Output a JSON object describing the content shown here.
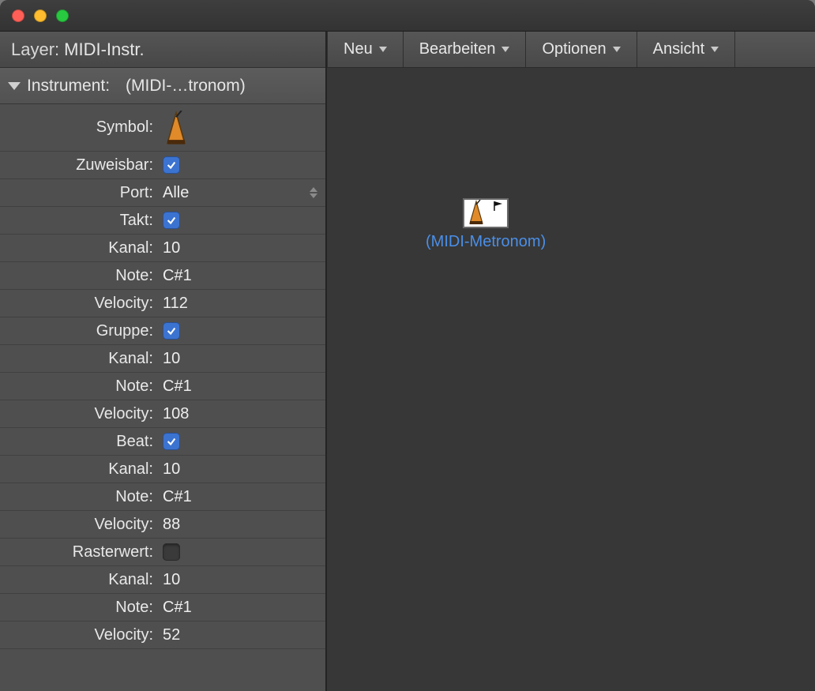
{
  "layer": {
    "prefix": "Layer:",
    "name": "MIDI-Instr."
  },
  "instrument": {
    "prefix": "Instrument:",
    "name": "(MIDI-…tronom)"
  },
  "labels": {
    "symbol": "Symbol:",
    "zuweisbar": "Zuweisbar:",
    "port": "Port:",
    "takt": "Takt:",
    "kanal": "Kanal:",
    "note": "Note:",
    "velocity": "Velocity:",
    "gruppe": "Gruppe:",
    "beat": "Beat:",
    "rasterwert": "Rasterwert:"
  },
  "values": {
    "port": "Alle",
    "sections": {
      "takt": {
        "kanal": "10",
        "note": "C#1",
        "velocity": "112"
      },
      "gruppe": {
        "kanal": "10",
        "note": "C#1",
        "velocity": "108"
      },
      "beat": {
        "kanal": "10",
        "note": "C#1",
        "velocity": "88"
      },
      "rasterwert": {
        "kanal": "10",
        "note": "C#1",
        "velocity": "52"
      }
    },
    "checks": {
      "zuweisbar": true,
      "takt": true,
      "gruppe": true,
      "beat": true,
      "rasterwert": false
    }
  },
  "toolbar": {
    "neu": "Neu",
    "bearbeiten": "Bearbeiten",
    "optionen": "Optionen",
    "ansicht": "Ansicht"
  },
  "canvas": {
    "object_label": "(MIDI-Metronom)"
  },
  "icons": {
    "metronome": "metronome-icon",
    "flag": "flag-icon"
  }
}
